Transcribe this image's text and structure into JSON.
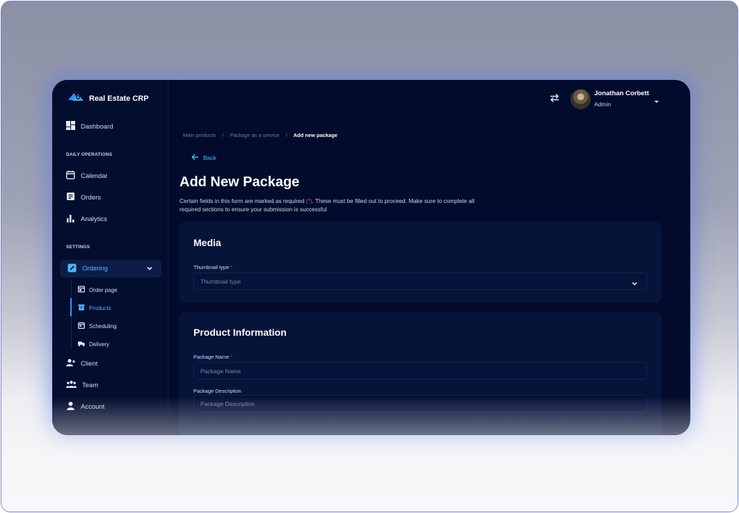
{
  "app": {
    "name": "Real Estate CRP"
  },
  "sidebar": {
    "dashboard": "Dashboard",
    "section_daily": "DAILY OPERATIONS",
    "calendar": "Calendar",
    "orders": "Orders",
    "analytics": "Analytics",
    "section_settings": "SETTINGS",
    "ordering": "Ordering",
    "sub": {
      "order_page": "Order page",
      "products": "Products",
      "scheduling": "Scheduling",
      "delivery": "Delivery"
    },
    "client": "Client",
    "team": "Team",
    "account": "Account"
  },
  "header": {
    "user_name": "Jonathan Corbett",
    "user_role": "Admin"
  },
  "breadcrumb": {
    "items": [
      "Main products",
      "Package as a service",
      "Add new package"
    ],
    "separator": "/"
  },
  "back_label": "Back",
  "page": {
    "title": "Add New Package",
    "desc_part1": "Certain fields in this form are marked as required ",
    "desc_req": "(*)",
    "desc_part2": ". These must be filled out to proceed. Make sure to complete all required sections to ensure your submission is successful"
  },
  "media": {
    "title": "Media",
    "thumbnail_label": "Thumbnail type",
    "thumbnail_placeholder": "Thumbnail type",
    "required_mark": "*"
  },
  "product_info": {
    "title": "Product Information",
    "name_label": "Package Name",
    "name_placeholder": "Package Name",
    "desc_label": "Package Description",
    "desc_placeholder": "Package Description",
    "required_mark": "*"
  },
  "colors": {
    "background": "#020b2b",
    "accent": "#4db8ff",
    "required": "#e04848"
  }
}
